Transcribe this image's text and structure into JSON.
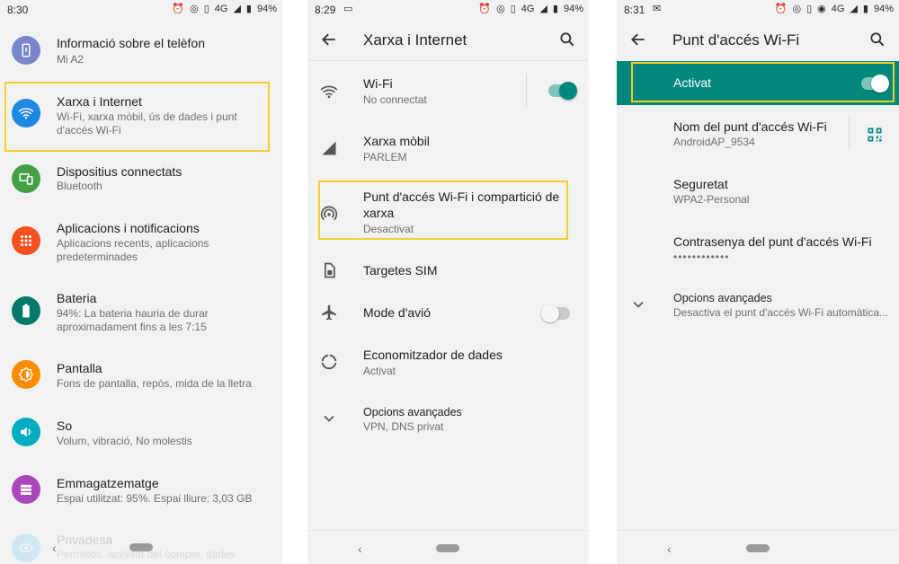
{
  "colors": {
    "accent": "#00897b",
    "highlight": "#f2cf2a",
    "network": "#1e88e5",
    "devices": "#43a047",
    "apps": "#f4511e",
    "battery": "#00796b",
    "display": "#fb8c00",
    "sound": "#00acc1",
    "storage": "#ab47bc",
    "privacy": "#29b6f6"
  },
  "screen1": {
    "status": {
      "time": "8:30",
      "network": "4G",
      "battery": "94%"
    },
    "items": [
      {
        "title": "Informació sobre el telèfon",
        "subtitle": "Mi A2",
        "icon": "phone-info-icon"
      },
      {
        "title": "Xarxa i Internet",
        "subtitle": "Wi-Fi, xarxa mòbil, ús de dades i punt d'accés Wi-Fi",
        "icon": "wifi-icon"
      },
      {
        "title": "Dispositius connectats",
        "subtitle": "Bluetooth",
        "icon": "connected-devices-icon"
      },
      {
        "title": "Aplicacions i notificacions",
        "subtitle": "Aplicacions recents, aplicacions predeterminades",
        "icon": "apps-grid-icon"
      },
      {
        "title": "Bateria",
        "subtitle": "94%: La bateria hauria de durar aproximadament fins a les 7:15",
        "icon": "battery-icon"
      },
      {
        "title": "Pantalla",
        "subtitle": "Fons de pantalla, repòs, mida de la lletra",
        "icon": "brightness-icon"
      },
      {
        "title": "So",
        "subtitle": "Volum, vibració, No molestis",
        "icon": "volume-icon"
      },
      {
        "title": "Emmagatzematge",
        "subtitle": "Espai utilitzat: 95%. Espai lliure: 3,03 GB",
        "icon": "storage-icon"
      },
      {
        "title": "Privadesa",
        "subtitle": "Permisos, activitat del compte, dades",
        "icon": "privacy-eye-icon"
      }
    ]
  },
  "screen2": {
    "status": {
      "time": "8:29",
      "network": "4G",
      "battery": "94%"
    },
    "title": "Xarxa i Internet",
    "items": [
      {
        "title": "Wi-Fi",
        "subtitle": "No connectat",
        "icon": "wifi-icon",
        "toggle": true
      },
      {
        "title": "Xarxa mòbil",
        "subtitle": "PARLEM",
        "icon": "signal-icon"
      },
      {
        "title": "Punt d'accés Wi-Fi i compartició de xarxa",
        "subtitle": "Desactivat",
        "icon": "hotspot-icon"
      },
      {
        "title": "Targetes SIM",
        "subtitle": "",
        "icon": "sim-card-icon"
      },
      {
        "title": "Mode d'avió",
        "subtitle": "",
        "icon": "airplane-icon",
        "toggle": false
      },
      {
        "title": "Economitzador de dades",
        "subtitle": "Activat",
        "icon": "data-saver-icon"
      },
      {
        "title": "Opcions avançades",
        "subtitle": "VPN, DNS privat",
        "icon": "chevron-down-icon"
      }
    ]
  },
  "screen3": {
    "status": {
      "time": "8:31",
      "network": "4G",
      "battery": "94%"
    },
    "title": "Punt d'accés Wi-Fi",
    "master": {
      "label": "Activat",
      "on": true
    },
    "items": [
      {
        "title": "Nom del punt d'accés Wi-Fi",
        "subtitle": "AndroidAP_9534",
        "icon": "qr-code-icon"
      },
      {
        "title": "Seguretat",
        "subtitle": "WPA2-Personal"
      },
      {
        "title": "Contrasenya del punt d'accés Wi-Fi",
        "subtitle": "••••••••••••"
      },
      {
        "title": "Opcions avançades",
        "subtitle": "Desactiva el punt d'accés Wi-Fi automàtica...",
        "icon": "chevron-down-icon"
      }
    ]
  }
}
